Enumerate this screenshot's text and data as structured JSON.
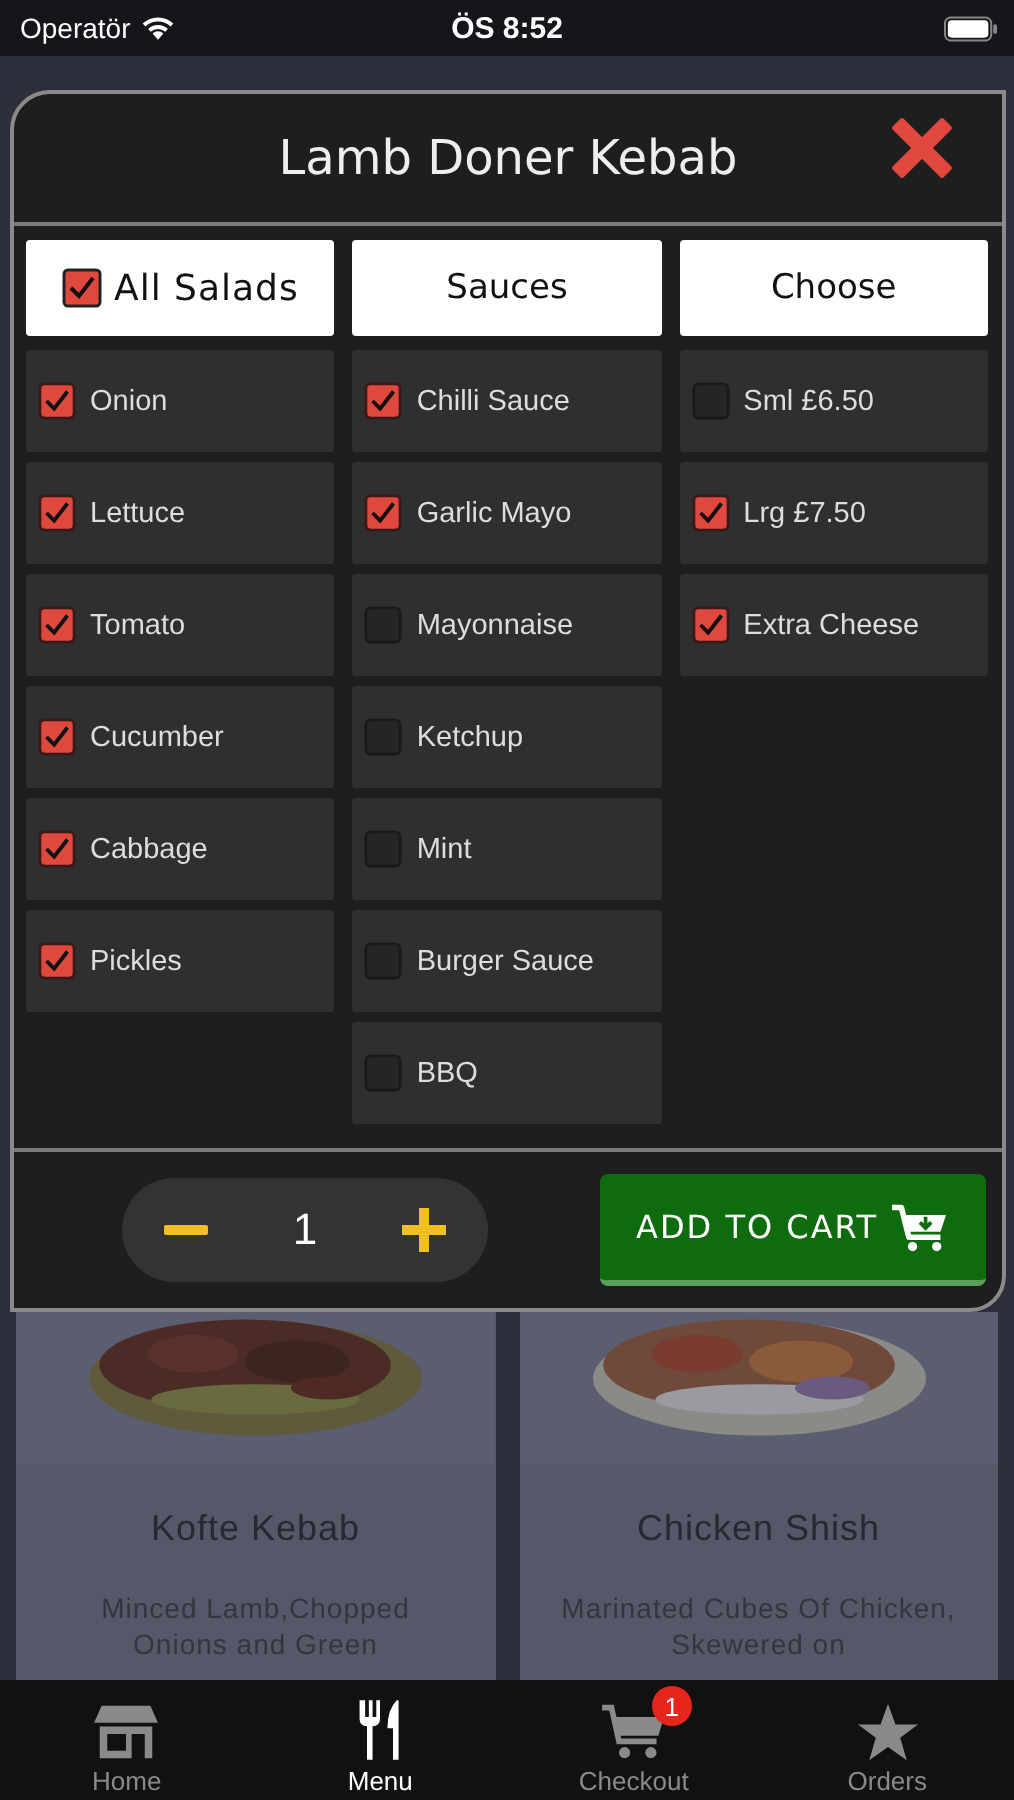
{
  "status_bar": {
    "carrier": "Operatör",
    "time": "ÖS 8:52"
  },
  "modal": {
    "title": "Lamb Doner Kebab",
    "columns": [
      {
        "header": {
          "label": "All Salads",
          "kind": "checkbox",
          "checked": true
        },
        "items": [
          {
            "label": "Onion",
            "checked": true
          },
          {
            "label": "Lettuce",
            "checked": true
          },
          {
            "label": "Tomato",
            "checked": true
          },
          {
            "label": "Cucumber",
            "checked": true
          },
          {
            "label": "Cabbage",
            "checked": true
          },
          {
            "label": "Pickles",
            "checked": true
          }
        ]
      },
      {
        "header": {
          "label": "Sauces",
          "kind": "plain"
        },
        "items": [
          {
            "label": "Chilli Sauce",
            "checked": true
          },
          {
            "label": "Garlic Mayo",
            "checked": true
          },
          {
            "label": "Mayonnaise",
            "checked": false
          },
          {
            "label": "Ketchup",
            "checked": false
          },
          {
            "label": "Mint",
            "checked": false
          },
          {
            "label": "Burger Sauce",
            "checked": false
          },
          {
            "label": "BBQ",
            "checked": false
          }
        ]
      },
      {
        "header": {
          "label": "Choose",
          "kind": "plain"
        },
        "items": [
          {
            "label": "Sml £6.50",
            "checked": false
          },
          {
            "label": "Lrg £7.50",
            "checked": true
          },
          {
            "label": "Extra Cheese",
            "checked": true
          }
        ]
      }
    ],
    "quantity": "1",
    "add_button": "ADD TO CART"
  },
  "menu_cards": [
    {
      "kind": "picture",
      "title": "Kofte Kebab",
      "description": "Minced Lamb,Chopped Onions and Green"
    },
    {
      "kind": "picture",
      "title": "Chicken Shish",
      "description": "Marinated Cubes Of Chicken, Skewered on"
    }
  ],
  "tab_bar": [
    {
      "label": "Home",
      "kind": "store",
      "selected": false
    },
    {
      "label": "Menu",
      "kind": "cutlery",
      "selected": true
    },
    {
      "label": "Checkout",
      "kind": "cart",
      "selected": false,
      "badge": "1"
    },
    {
      "label": "Orders",
      "kind": "star",
      "selected": false
    }
  ]
}
